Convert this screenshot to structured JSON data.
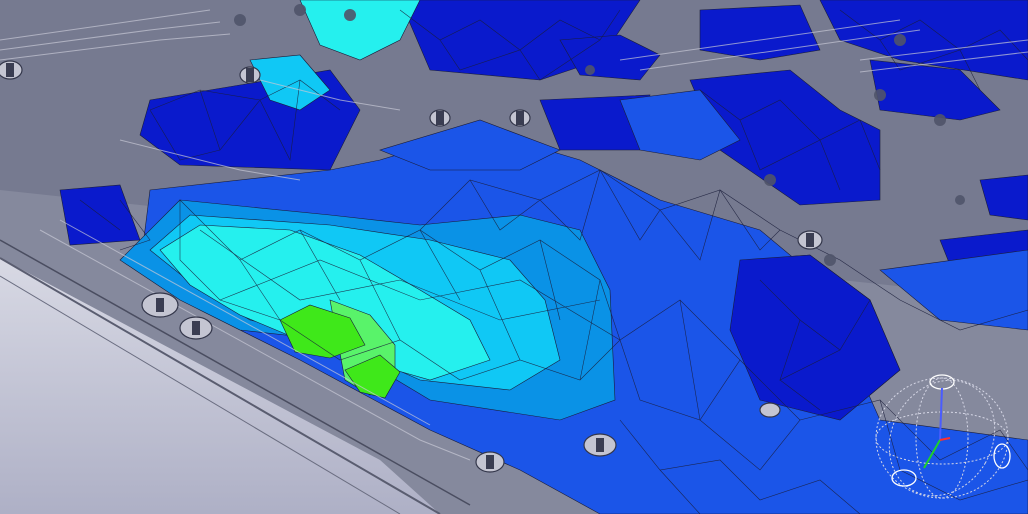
{
  "viewport": {
    "background": "#7b7f93",
    "board_surface": "#85899d",
    "board_edge": "#c9cad6",
    "mesh_line": "#1a1d3a",
    "field_colors": {
      "lowest": "#0a1acc",
      "low": "#1b55e8",
      "mid_low": "#0a92e6",
      "mid": "#10c8f5",
      "mid_high": "#25f0ee",
      "high": "#59f36a",
      "peak": "#3fe81a"
    },
    "icons": {
      "orientation": "orientation-sphere-icon",
      "mounting_hole": "mounting-hole-icon",
      "screw": "screw-icon"
    }
  }
}
